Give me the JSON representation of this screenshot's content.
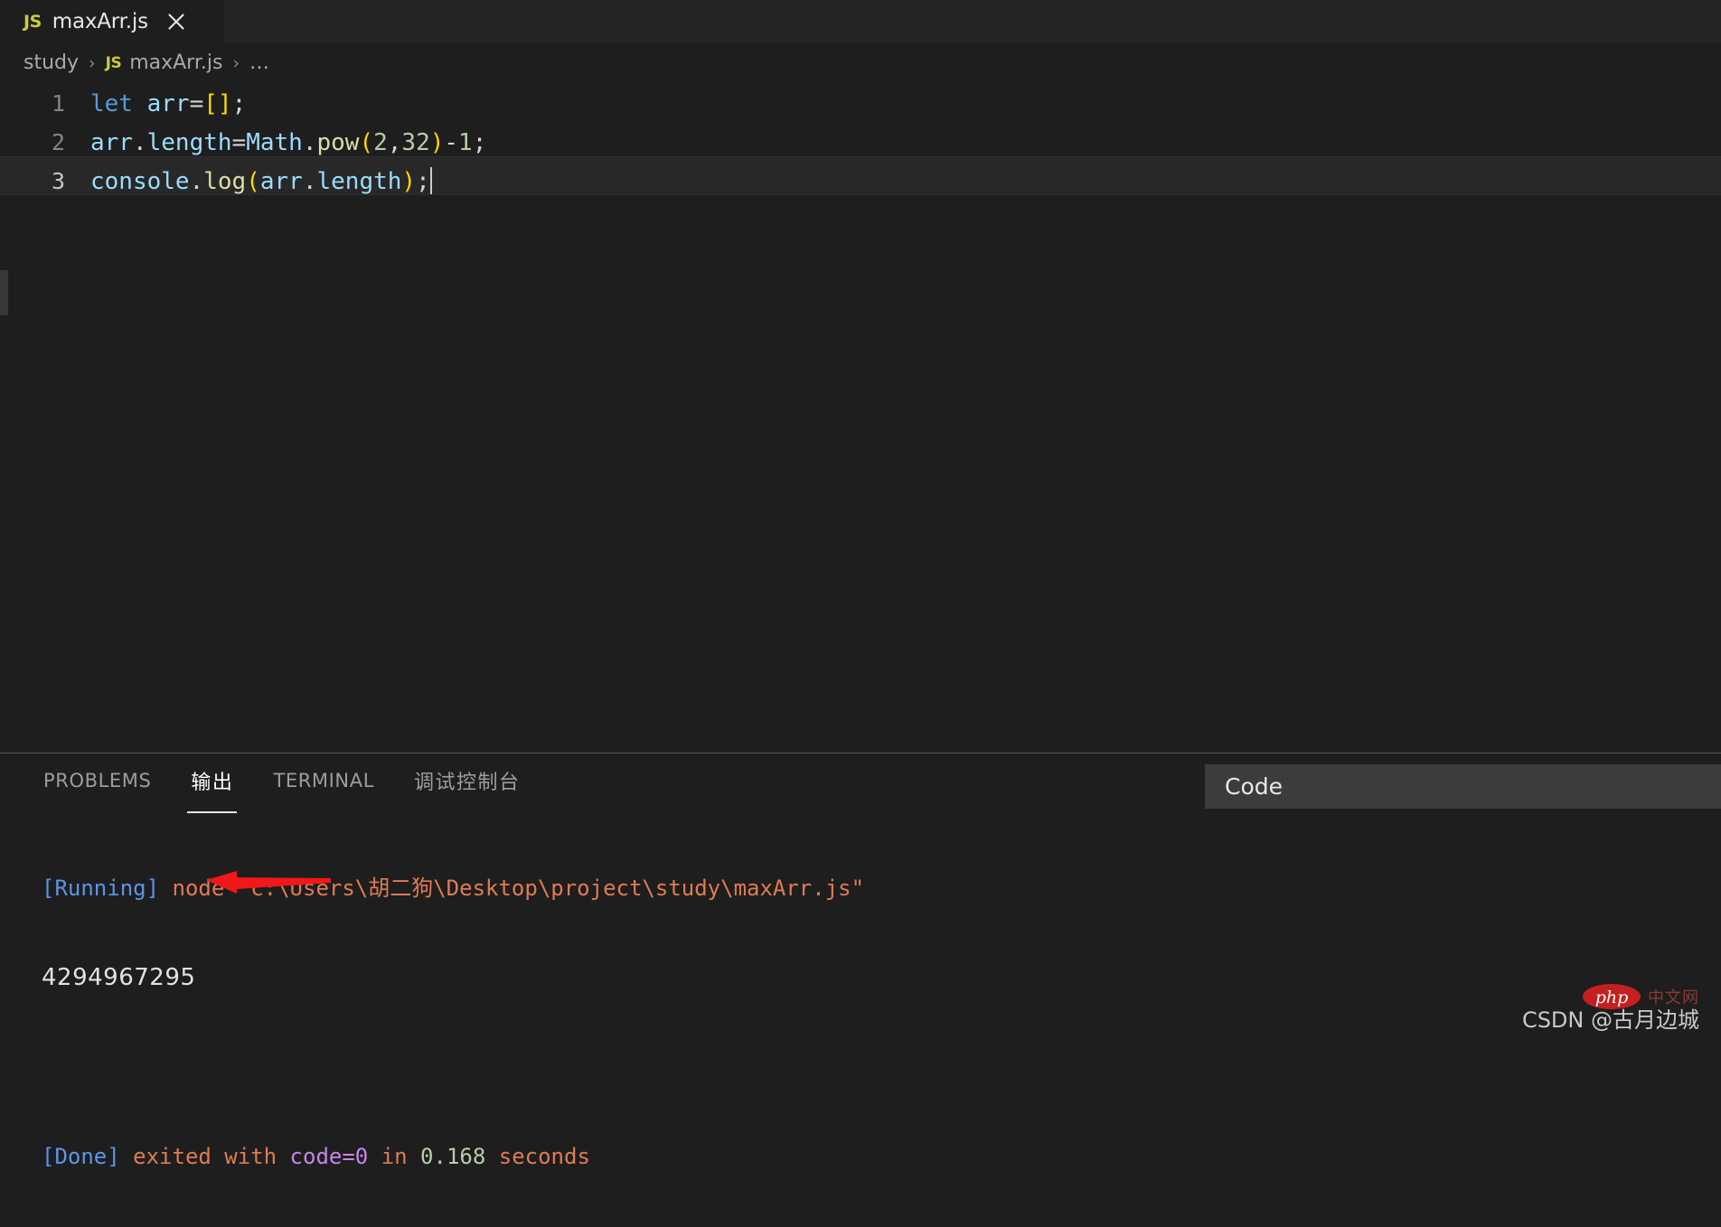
{
  "tab": {
    "file_icon": "JS",
    "label": "maxArr.js",
    "close_icon": "close-icon"
  },
  "breadcrumb": {
    "root": "study",
    "sep": "›",
    "file_icon": "JS",
    "file": "maxArr.js",
    "overflow": "…"
  },
  "editor": {
    "lines": [
      {
        "number": "1",
        "tokens": [
          {
            "text": "let",
            "cls": "t-kw"
          },
          {
            "text": " ",
            "cls": "t-op"
          },
          {
            "text": "arr",
            "cls": "t-var"
          },
          {
            "text": "=",
            "cls": "t-op"
          },
          {
            "text": "[]",
            "cls": "t-punct"
          },
          {
            "text": ";",
            "cls": "t-op"
          }
        ]
      },
      {
        "number": "2",
        "tokens": [
          {
            "text": "arr",
            "cls": "t-var"
          },
          {
            "text": ".",
            "cls": "t-op"
          },
          {
            "text": "length",
            "cls": "t-prop"
          },
          {
            "text": "=",
            "cls": "t-op"
          },
          {
            "text": "Math",
            "cls": "t-var"
          },
          {
            "text": ".",
            "cls": "t-op"
          },
          {
            "text": "pow",
            "cls": "t-func"
          },
          {
            "text": "(",
            "cls": "t-punct"
          },
          {
            "text": "2",
            "cls": "t-num"
          },
          {
            "text": ",",
            "cls": "t-op"
          },
          {
            "text": "32",
            "cls": "t-num"
          },
          {
            "text": ")",
            "cls": "t-punct"
          },
          {
            "text": "-",
            "cls": "t-op"
          },
          {
            "text": "1",
            "cls": "t-num"
          },
          {
            "text": ";",
            "cls": "t-op"
          }
        ]
      },
      {
        "number": "3",
        "active": true,
        "tokens": [
          {
            "text": "console",
            "cls": "t-var"
          },
          {
            "text": ".",
            "cls": "t-op"
          },
          {
            "text": "log",
            "cls": "t-func"
          },
          {
            "text": "(",
            "cls": "t-punct"
          },
          {
            "text": "arr",
            "cls": "t-var"
          },
          {
            "text": ".",
            "cls": "t-op"
          },
          {
            "text": "length",
            "cls": "t-prop"
          },
          {
            "text": ")",
            "cls": "t-punct"
          },
          {
            "text": ";",
            "cls": "t-op"
          }
        ]
      }
    ]
  },
  "panel": {
    "tabs": [
      {
        "label": "PROBLEMS",
        "active": false,
        "cjk": false
      },
      {
        "label": "输出",
        "active": true,
        "cjk": true
      },
      {
        "label": "TERMINAL",
        "active": false,
        "cjk": false
      },
      {
        "label": "调试控制台",
        "active": false,
        "cjk": true
      }
    ],
    "code_select_value": "Code",
    "output": {
      "running_tag": "[Running]",
      "running_cmd": " node \"c:\\Users\\胡二狗\\Desktop\\project\\study\\maxArr.js\"",
      "result_value": "4294967295",
      "done_tag": "[Done]",
      "done_text1": " exited with ",
      "done_code": "code=0",
      "done_text2": " in ",
      "done_time": "0.168",
      "done_text3": " seconds"
    }
  },
  "annotation": {
    "arrow_color": "#f01818",
    "arrow_name": "red-arrow-pointing-to-output-value"
  },
  "watermark": {
    "text": "CSDN @古月边城",
    "logo_text": "php",
    "cn_text": "中文网"
  }
}
